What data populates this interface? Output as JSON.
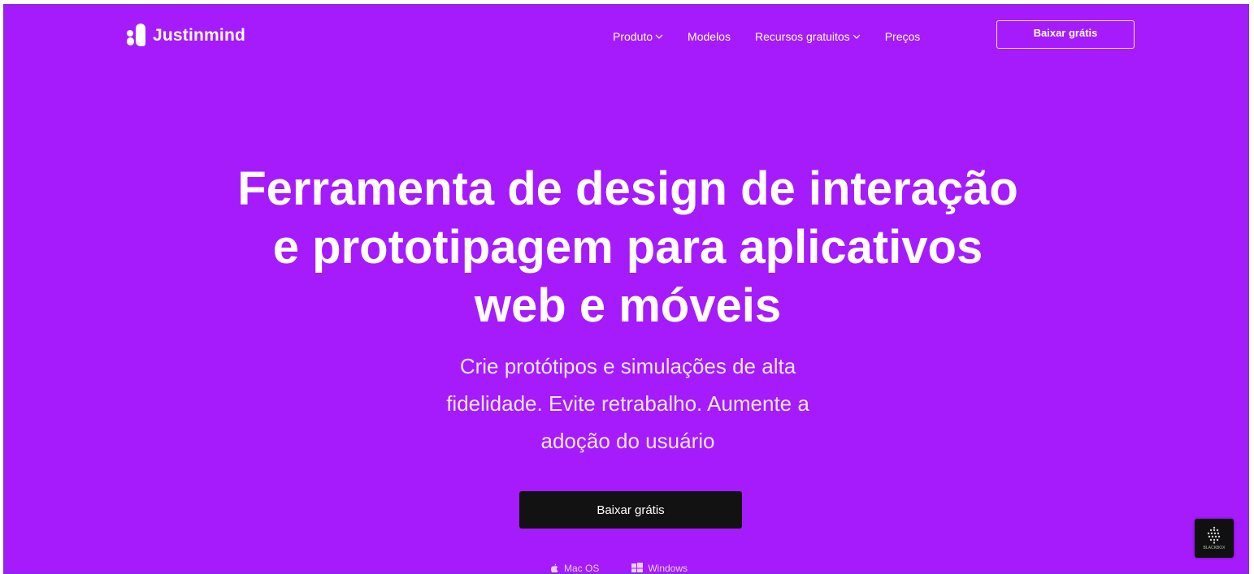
{
  "colors": {
    "background": "#a51bfc",
    "cta_background": "#121212",
    "text": "#ffffff"
  },
  "header": {
    "logo_text": "Justinmind",
    "nav": {
      "produto": "Produto",
      "modelos": "Modelos",
      "recursos": "Recursos gratuitos",
      "precos": "Preços"
    },
    "download_button": "Baixar grátis"
  },
  "hero": {
    "title_lines": [
      "Ferramenta de design de interação",
      "e prototipagem para aplicativos",
      "web e móveis"
    ],
    "subtitle_lines": [
      "Crie protótipos e simulações de alta",
      "fidelidade. Evite retrabalho. Aumente a",
      "adoção do usuário"
    ],
    "cta_label": "Baixar grátis",
    "platforms": {
      "mac": "Mac OS",
      "windows": "Windows"
    }
  },
  "widget": {
    "label": "BLACKBOX",
    "icon": "blackbox-icon"
  }
}
